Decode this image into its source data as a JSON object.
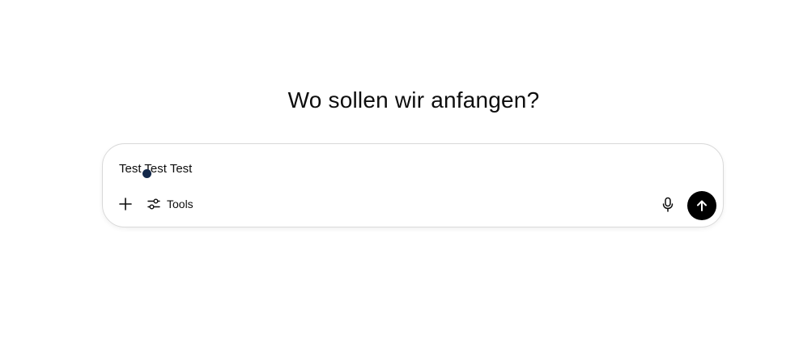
{
  "heading": "Wo sollen wir anfangen?",
  "composer": {
    "input_value": "Test Test Test",
    "tools_label": "Tools"
  },
  "icons": {
    "add": "plus-icon",
    "tools": "sliders-icon",
    "voice": "microphone-icon",
    "send": "arrow-up-icon"
  },
  "colors": {
    "send_button": "#000000",
    "cursor_dot": "#13284a"
  }
}
